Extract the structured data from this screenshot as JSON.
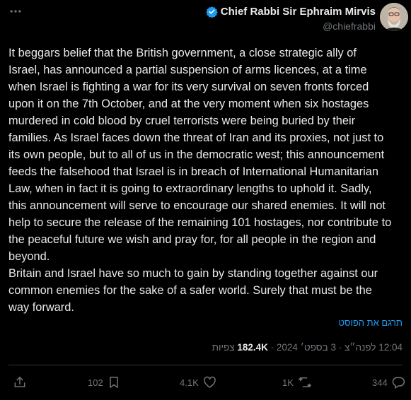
{
  "author": {
    "name": "Chief Rabbi Sir Ephraim Mirvis",
    "handle": "@chiefrabbi",
    "verified_color": "#1d9bf0"
  },
  "tweet": {
    "text": "It beggars belief that the British government, a close strategic ally of\nIsrael, has announced a partial suspension of arms licences, at a time\nwhen Israel is fighting a war for its very survival on seven fronts forced\nupon it on the 7th October, and at the very moment when six hostages\nmurdered in cold blood by cruel terrorists were being buried by their\nfamilies. As Israel faces down the threat of Iran and its proxies, not just to\nits own people, but to all of us in the democratic west; this announcement\nfeeds the falsehood that Israel is in breach of International Humanitarian\nLaw, when in fact it is going to extraordinary lengths to uphold it. Sadly,\nthis announcement will serve to encourage our shared enemies. It will not\nhelp to secure the release of the remaining 101 hostages, nor contribute to\nthe peaceful future we wish and pray for, for all people in the region and\nbeyond.\nBritain and Israel have so much to gain by standing together against our\ncommon enemies for the sake of a safer world. Surely that must be the\nway forward.",
    "translate_label": "תרגם את הפוסט",
    "time": "12:04 לפנה״צ",
    "date": "3 בספט׳ 2024",
    "views_count": "182.4K",
    "views_label": "צפיות"
  },
  "actions": {
    "replies": "344",
    "retweets": "1K",
    "likes": "4.1K",
    "bookmarks": "102"
  },
  "icons": {
    "more": "more-icon",
    "verified": "verified-badge-icon",
    "reply": "reply-icon",
    "retweet": "retweet-icon",
    "like": "heart-icon",
    "bookmark": "bookmark-icon",
    "share": "share-icon"
  },
  "colors": {
    "background": "#000000",
    "text": "#e7e9ea",
    "secondary": "#71767b",
    "link": "#1d9bf0",
    "divider": "#2f3336"
  }
}
